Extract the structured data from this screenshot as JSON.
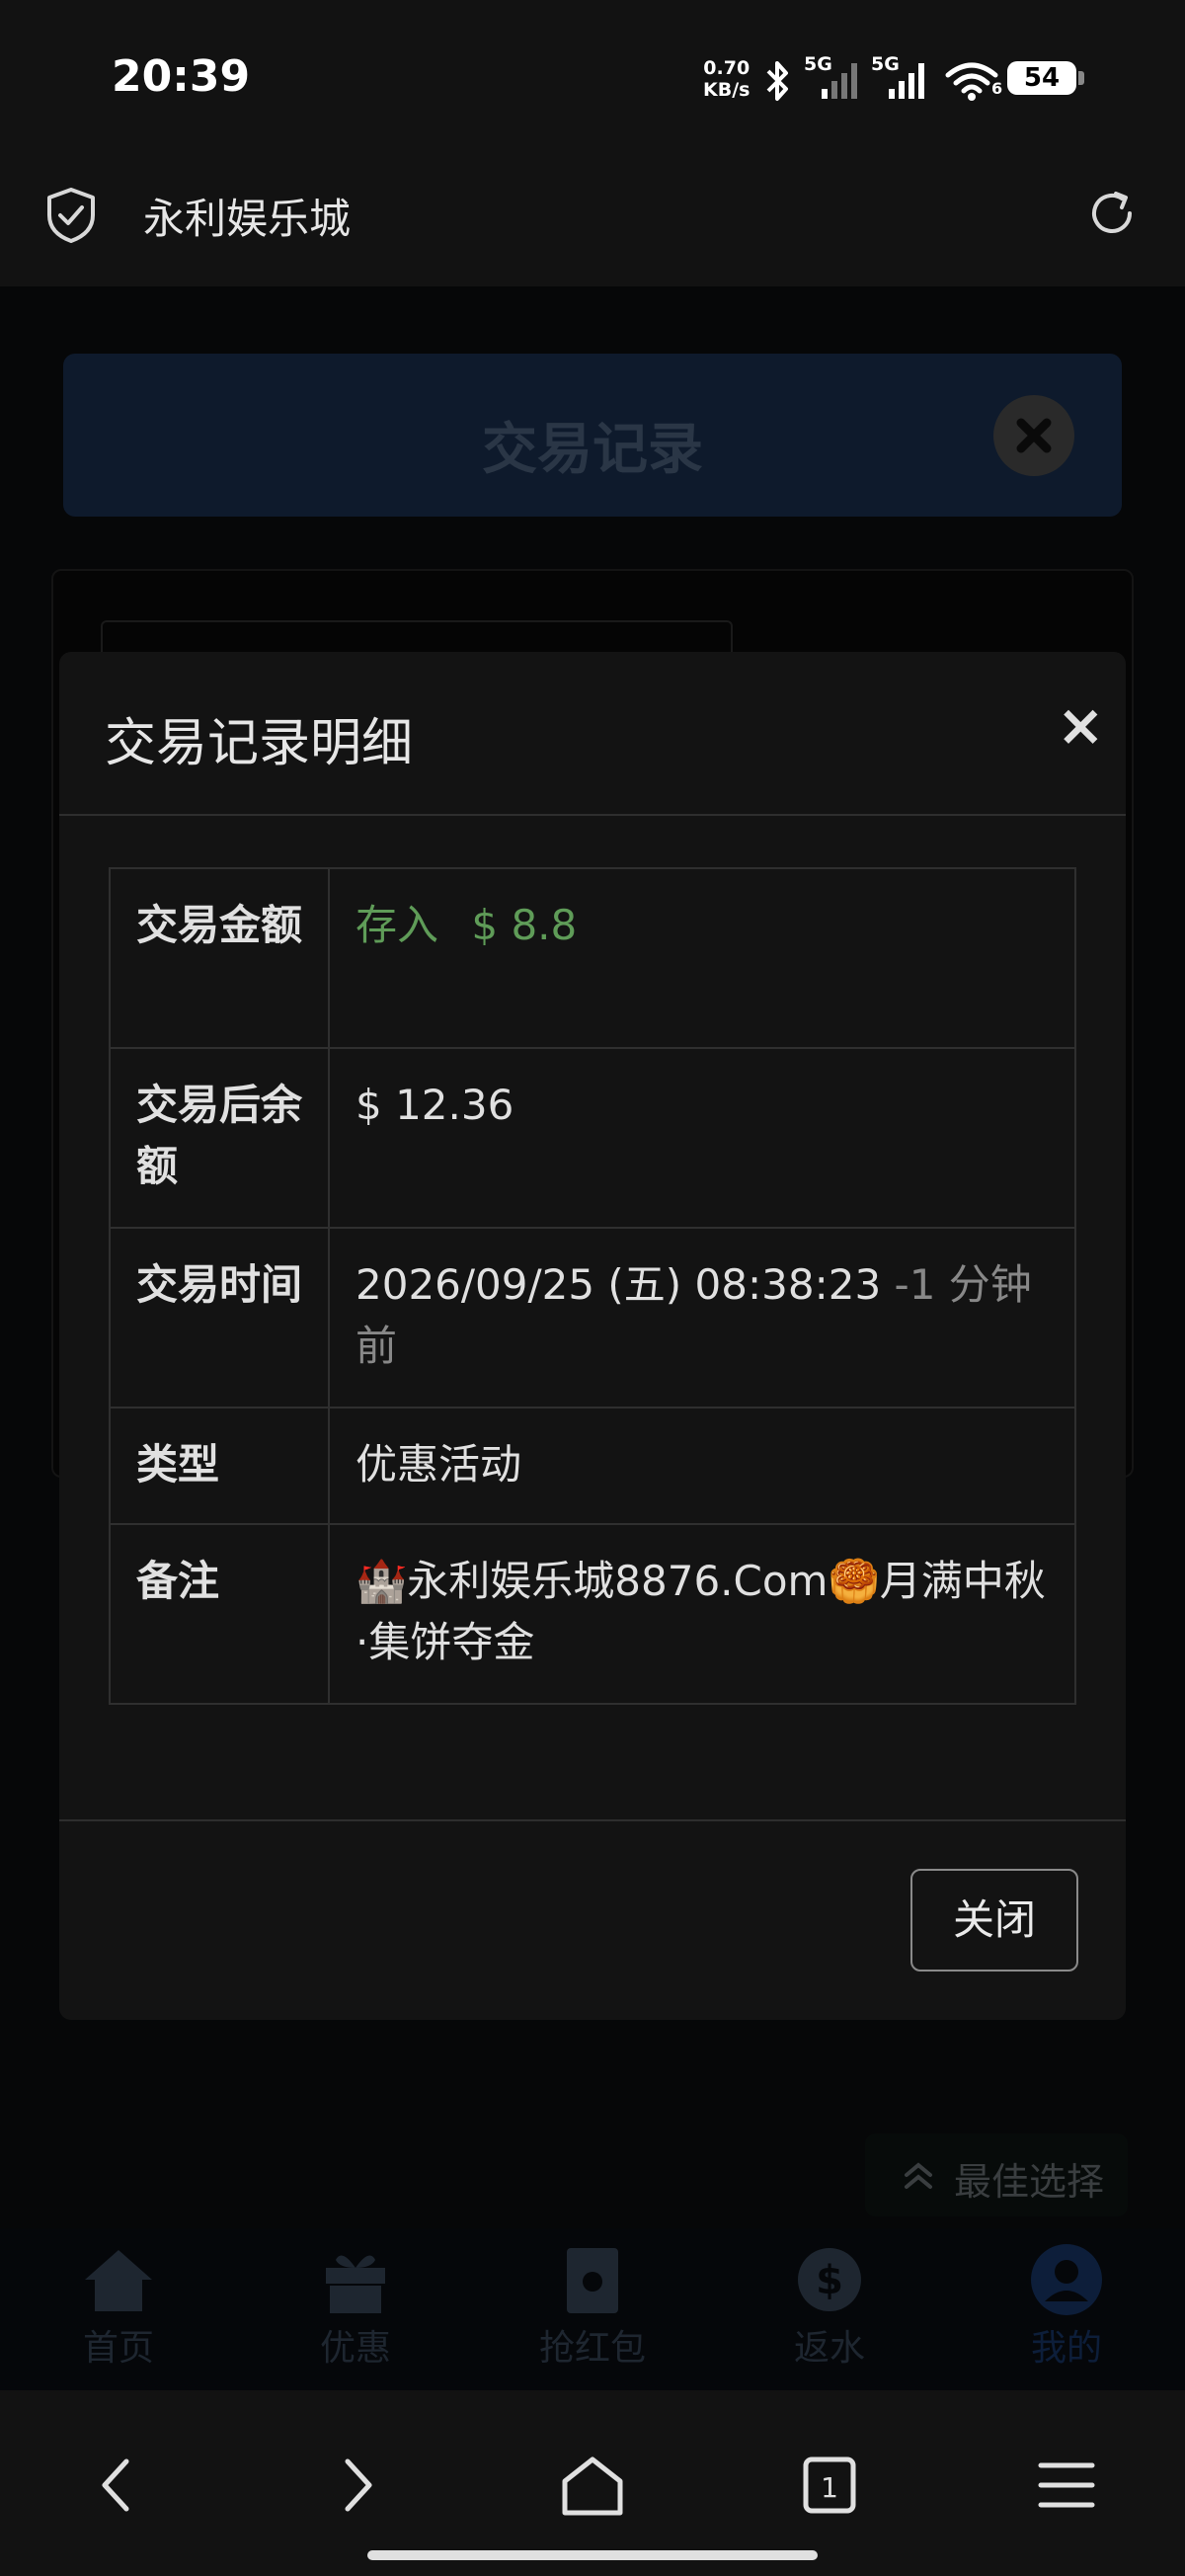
{
  "status_bar": {
    "time": "20:39",
    "net_speed_value": "0.70",
    "net_speed_unit": "KB/s",
    "signal1_label": "5G",
    "signal2_label": "5G",
    "wifi_label": "6",
    "battery": "54"
  },
  "browser": {
    "site_title": "永利娱乐城"
  },
  "background_page": {
    "header_title": "交易记录",
    "best_choice": "最佳选择",
    "tabs": [
      {
        "label": "首页",
        "icon": "home-icon"
      },
      {
        "label": "优惠",
        "icon": "gift-icon"
      },
      {
        "label": "抢红包",
        "icon": "red-envelope-icon"
      },
      {
        "label": "返水",
        "icon": "dollar-badge-icon"
      },
      {
        "label": "我的",
        "icon": "user-icon"
      }
    ]
  },
  "modal": {
    "title": "交易记录明细",
    "close_button": "关闭",
    "rows": [
      {
        "key": "交易金额",
        "value_type": "存入",
        "value_amount": "$ 8.8"
      },
      {
        "key": "交易后余额",
        "value": "$ 12.36"
      },
      {
        "key": "交易时间",
        "value": "2026/09/25 (五) 08:38:23",
        "value_extra": "-1 分钟前"
      },
      {
        "key": "类型",
        "value": "优惠活动"
      },
      {
        "key": "备注",
        "value_emoji1": "🏰",
        "value_text1": "永利娱乐城8876.Com",
        "value_emoji2": "🥮",
        "value_text2": "月满中秋·集饼夺金"
      }
    ]
  },
  "colors": {
    "deposit_green": "#5f9c58",
    "modal_bg": "#131313",
    "accent_bg_header": "#0e1a2c"
  }
}
